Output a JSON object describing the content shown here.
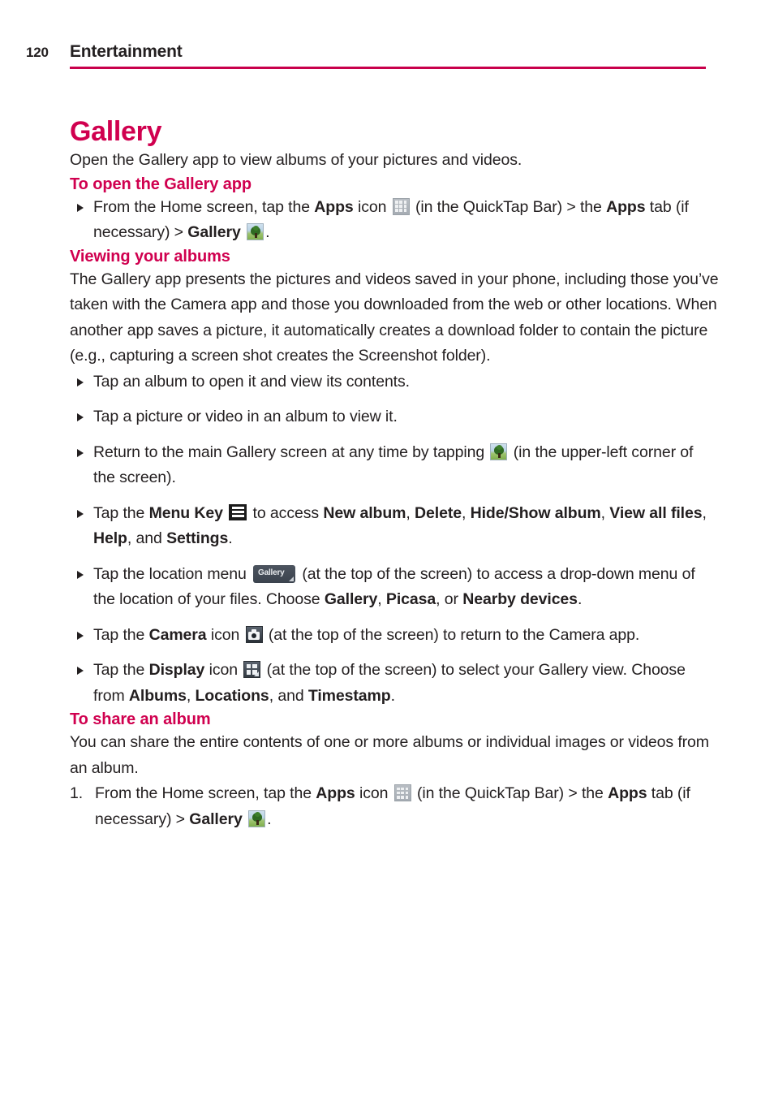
{
  "header": {
    "page_number": "120",
    "chapter": "Entertainment",
    "rule_color": "#c8004b"
  },
  "theme": {
    "accent_pink": "#d0004f",
    "body_text": "#231f20"
  },
  "section": {
    "title": "Gallery",
    "intro": "Open the Gallery app to view albums of your pictures and videos."
  },
  "open_gallery": {
    "heading": "To open the Gallery app",
    "bullet": {
      "p1": "From the Home screen, tap the ",
      "b1": "Apps",
      "p2": " icon ",
      "icon1": "apps-grid-icon",
      "p3": " (in the QuickTap Bar) > the ",
      "b2": "Apps",
      "p4": " tab (if necessary) > ",
      "b3": "Gallery",
      "icon2": "gallery-tree-icon",
      "p5": "."
    }
  },
  "viewing_albums": {
    "heading": "Viewing your albums",
    "paragraph": "The Gallery app presents the pictures and videos saved in your phone, including those you’ve taken with the Camera app and those you downloaded from the web or other locations. When another app saves a picture, it automatically creates a download folder to contain the picture (e.g., capturing a screen shot creates the Screenshot folder).",
    "bullets": {
      "b1": "Tap an album to open it and view its contents.",
      "b2": "Tap a picture or video in an album to view it.",
      "b3": {
        "p1": "Return to the main Gallery screen at any time by tapping ",
        "icon": "gallery-tree-icon",
        "p2": " (in the upper-left corner of the screen)."
      },
      "b4": {
        "p1": "Tap the ",
        "b1": "Menu Key",
        "p2": " ",
        "icon": "menu-key-icon",
        "p3": " to access ",
        "b2": "New album",
        "p4": ", ",
        "b3": "Delete",
        "p5": ", ",
        "b4": "Hide/Show album",
        "p6": ", ",
        "b5": "View all files",
        "p7": ", ",
        "b6": "Help",
        "p8": ", and ",
        "b7": "Settings",
        "p9": "."
      },
      "b5": {
        "p1": "Tap the location menu ",
        "icon": "location-menu-icon",
        "icon_label": "Gallery",
        "p2": " (at the top of the screen) to access a drop-down menu of the location of your files. Choose ",
        "b1": "Gallery",
        "p3": ", ",
        "b2": "Picasa",
        "p4": ", or ",
        "b3": "Nearby devices",
        "p5": "."
      },
      "b6": {
        "p1": "Tap the ",
        "b1": "Camera",
        "p2": " icon ",
        "icon": "camera-icon",
        "p3": " (at the top of the screen) to return to the Camera app."
      },
      "b7": {
        "p1": "Tap the ",
        "b1": "Display",
        "p2": " icon ",
        "icon": "display-grid-icon",
        "p3": " (at the top of the screen) to select your Gallery view. Choose from ",
        "b2": "Albums",
        "p4": ", ",
        "b3": "Locations",
        "p5": ", and ",
        "b4": "Timestamp",
        "p6": "."
      }
    }
  },
  "share_album": {
    "heading": "To share an album",
    "paragraph": "You can share the entire contents of one or more albums or individual images or videos from an album.",
    "step1": {
      "num": "1.",
      "p1": "From the Home screen, tap the ",
      "b1": "Apps",
      "p2": " icon ",
      "icon1": "apps-grid-icon",
      "p3": " (in the QuickTap Bar) > the ",
      "b2": "Apps",
      "p4": " tab (if necessary) > ",
      "b3": "Gallery",
      "icon2": "gallery-tree-icon",
      "p5": "."
    }
  }
}
